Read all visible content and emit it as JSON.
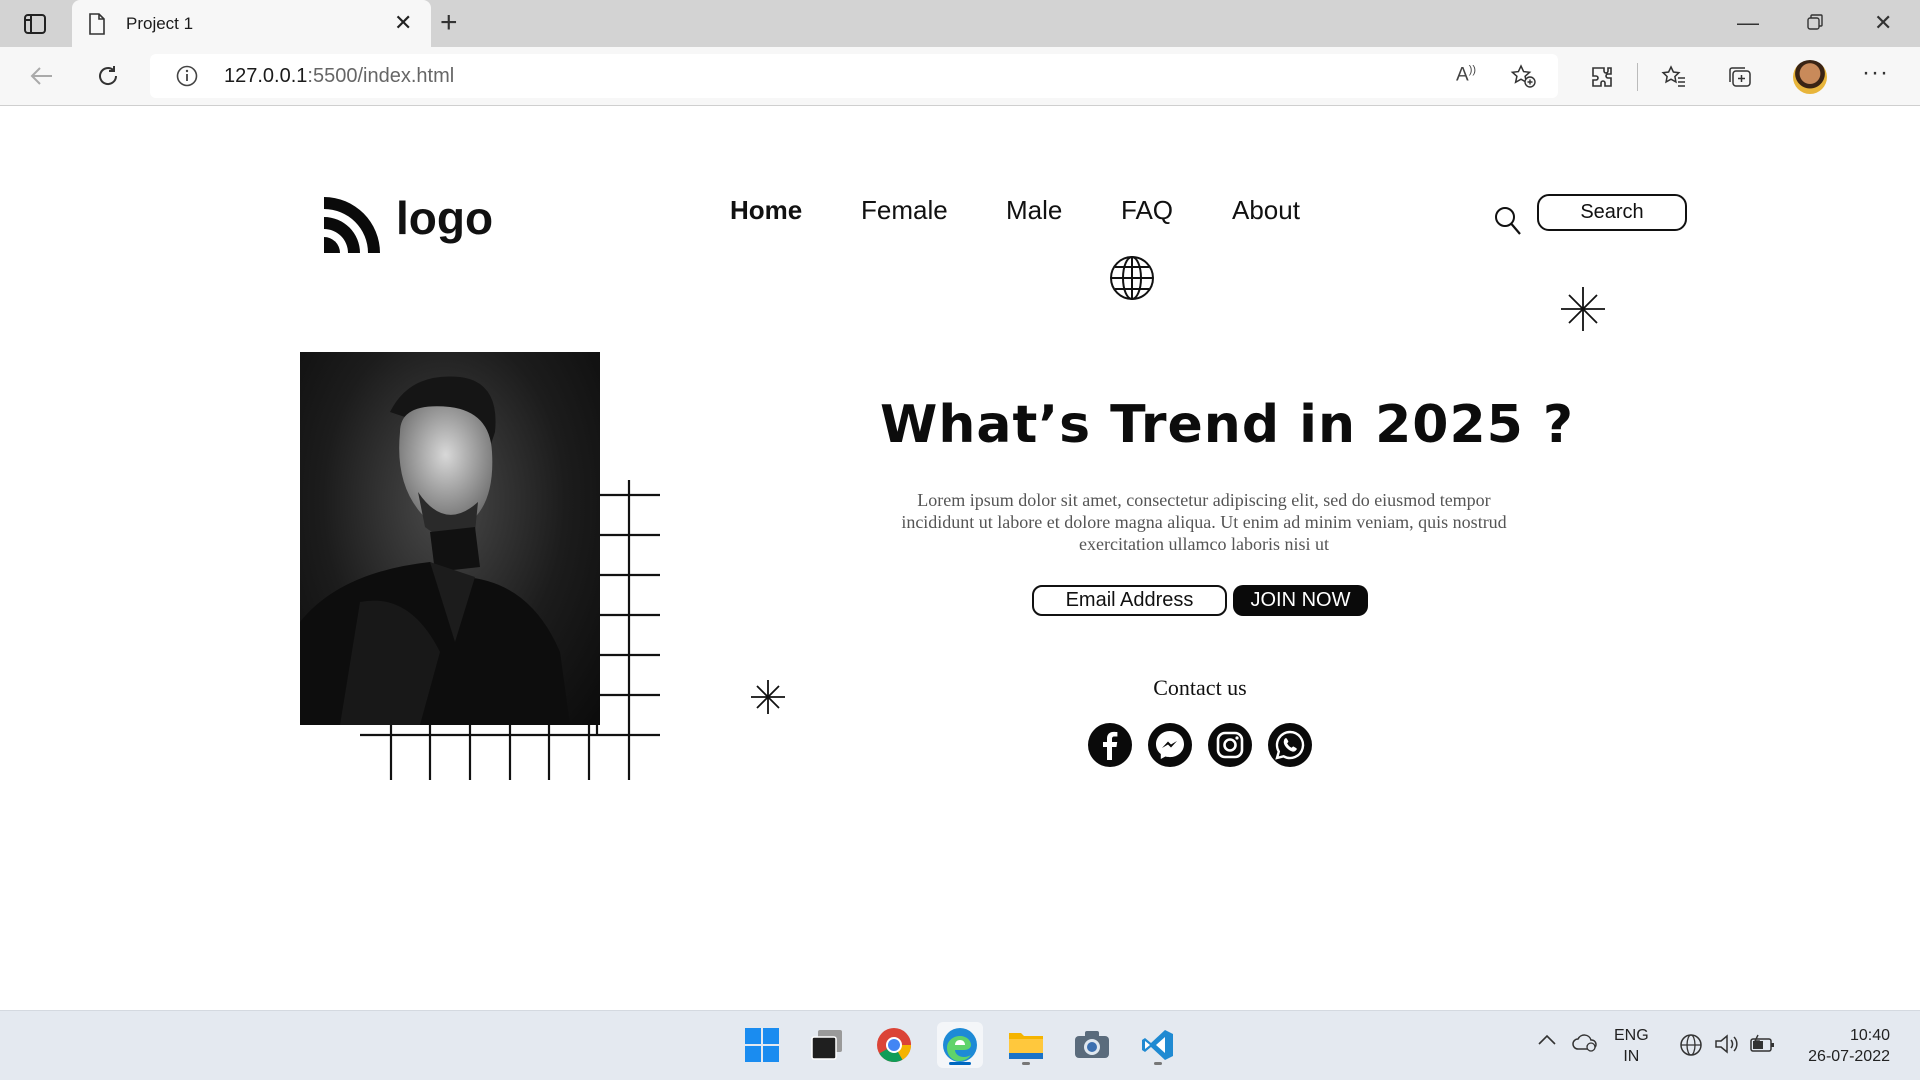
{
  "browser": {
    "tab_title": "Project 1",
    "url_host": "127.0.0.1",
    "url_rest": ":5500/index.html"
  },
  "site": {
    "logo_text": "logo",
    "nav": [
      {
        "label": "Home",
        "active": true
      },
      {
        "label": "Female",
        "active": false
      },
      {
        "label": "Male",
        "active": false
      },
      {
        "label": "FAQ",
        "active": false
      },
      {
        "label": "About",
        "active": false
      }
    ],
    "search_label": "Search",
    "headline": "What’s Trend in 2025 ?",
    "lorem": "Lorem ipsum dolor sit amet, consectetur adipiscing elit, sed do eiusmod tempor incididunt ut labore et dolore magna aliqua. Ut enim ad minim veniam, quis nostrud exercitation ullamco laboris nisi ut",
    "email_placeholder": "Email Address",
    "join_label": "JOIN NOW",
    "contact_label": "Contact us",
    "social": [
      "facebook-icon",
      "messenger-icon",
      "instagram-icon",
      "whatsapp-icon"
    ]
  },
  "taskbar": {
    "lang_line1": "ENG",
    "lang_line2": "IN",
    "time": "10:40",
    "date": "26-07-2022"
  }
}
